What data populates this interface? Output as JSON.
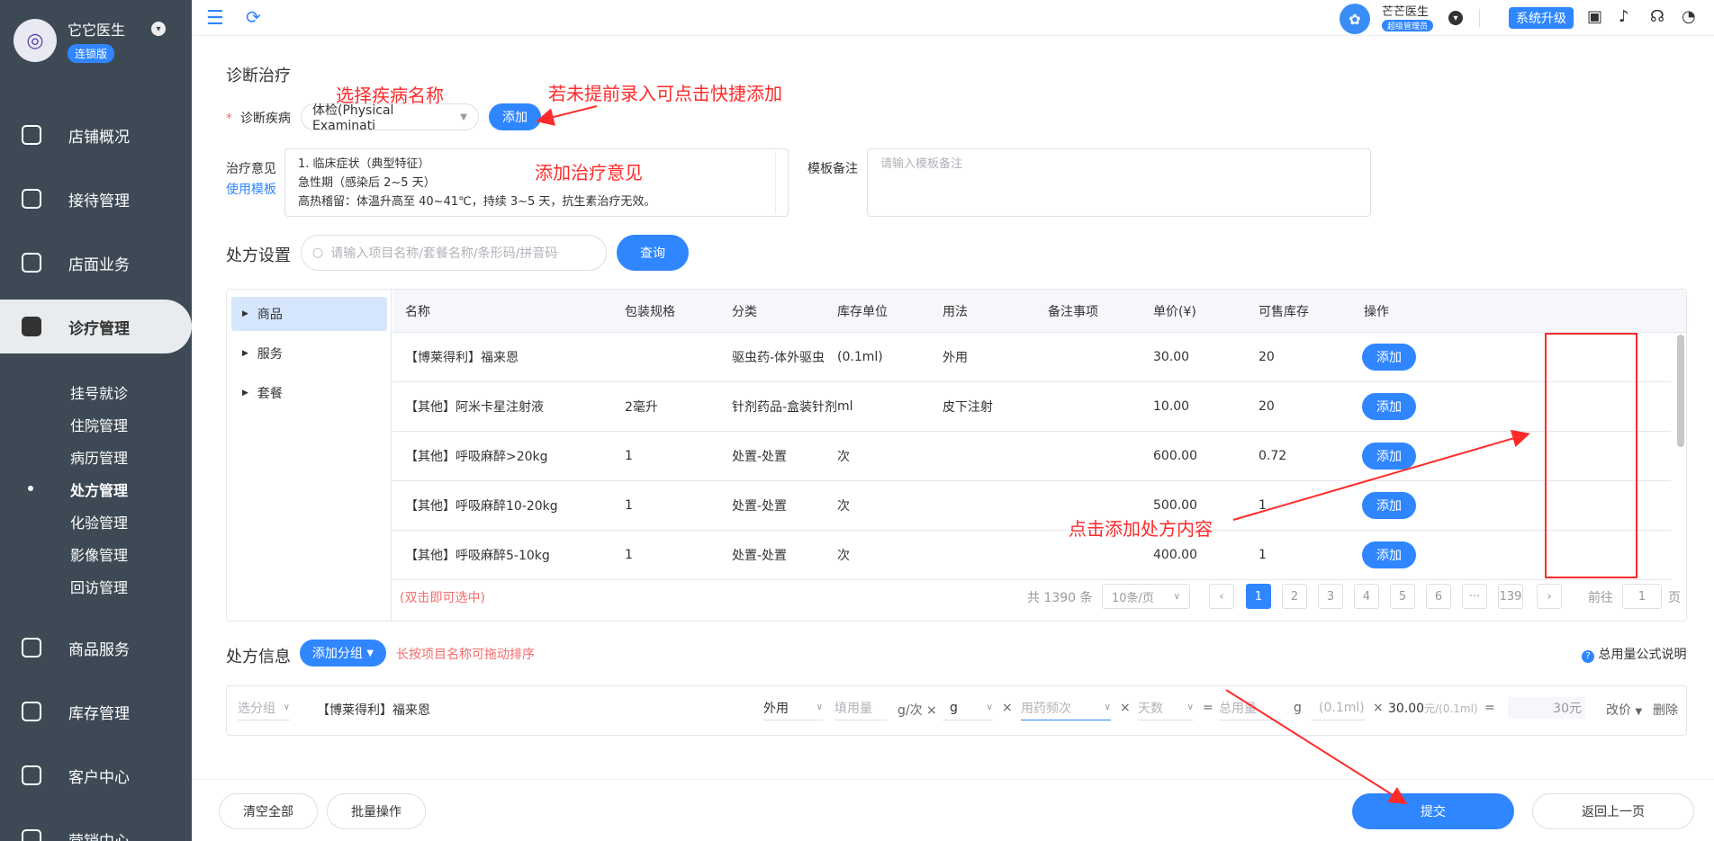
{
  "sidebar": {
    "brand_name": "它它医生",
    "brand_badge": "连锁版",
    "nav": [
      {
        "label": "店铺概况"
      },
      {
        "label": "接待管理"
      },
      {
        "label": "店面业务"
      },
      {
        "label": "诊疗管理"
      },
      {
        "label": "商品服务"
      },
      {
        "label": "库存管理"
      },
      {
        "label": "客户中心"
      },
      {
        "label": "营销中心"
      }
    ],
    "sub": [
      {
        "label": "挂号就诊"
      },
      {
        "label": "住院管理"
      },
      {
        "label": "病历管理"
      },
      {
        "label": "处方管理"
      },
      {
        "label": "化验管理"
      },
      {
        "label": "影像管理"
      },
      {
        "label": "回访管理"
      }
    ]
  },
  "topbar": {
    "user_name": "芒芒医生",
    "user_role": "超级管理员",
    "upgrade": "系统升级"
  },
  "diagnosis": {
    "title": "诊断治疗",
    "disease_label": "诊断疾病",
    "disease_value": "体检(Physical Examinati",
    "add_btn": "添加",
    "treatment_label": "治疗意见",
    "use_template": "使用模板",
    "treatment_lines": [
      "1. 临床症状（典型特征）",
      "急性期（感染后 2~5 天）",
      "高热稽留：体温升高至 40~41℃，持续 3~5 天，抗生素治疗无效。"
    ],
    "template_note_label": "模板备注",
    "template_note_placeholder": "请输入模板备注"
  },
  "annotations": {
    "select_disease": "选择疾病名称",
    "quick_add": "若未提前录入可点击快捷添加",
    "add_treatment": "添加治疗意见",
    "add_rx": "点击添加处方内容"
  },
  "rx_settings": {
    "title": "处方设置",
    "search_placeholder": "请输入项目名称/套餐名称/条形码/拼音码",
    "query_btn": "查询"
  },
  "tree": [
    "商品",
    "服务",
    "套餐"
  ],
  "table": {
    "headers": [
      "名称",
      "包装规格",
      "分类",
      "库存单位",
      "用法",
      "备注事项",
      "单价(¥)",
      "可售库存",
      "操作"
    ],
    "rows": [
      {
        "name": "【博莱得利】福来恩",
        "spec": "",
        "category": "驱虫药-体外驱虫",
        "unit": "(0.1ml)",
        "usage": "外用",
        "note": "",
        "price": "30.00",
        "stock": "20",
        "action": "添加"
      },
      {
        "name": "【其他】阿米卡星注射液",
        "spec": "2毫升",
        "category": "针剂药品-盒装针剂",
        "unit": "ml",
        "usage": "皮下注射",
        "note": "",
        "price": "10.00",
        "stock": "20",
        "action": "添加"
      },
      {
        "name": "【其他】呼吸麻醉>20kg",
        "spec": "1",
        "category": "处置-处置",
        "unit": "次",
        "usage": "",
        "note": "",
        "price": "600.00",
        "stock": "0.72",
        "action": "添加"
      },
      {
        "name": "【其他】呼吸麻醉10-20kg",
        "spec": "1",
        "category": "处置-处置",
        "unit": "次",
        "usage": "",
        "note": "",
        "price": "500.00",
        "stock": "1",
        "action": "添加"
      },
      {
        "name": "【其他】呼吸麻醉5-10kg",
        "spec": "1",
        "category": "处置-处置",
        "unit": "次",
        "usage": "",
        "note": "",
        "price": "400.00",
        "stock": "1",
        "action": "添加"
      }
    ],
    "dblclick_hint": "(双击即可选中)",
    "total": "共 1390 条",
    "page_size": "10条/页",
    "pages": [
      "1",
      "2",
      "3",
      "4",
      "5",
      "6",
      "···",
      "139"
    ],
    "goto_label": "前往",
    "goto_value": "1",
    "goto_unit": "页"
  },
  "rx_info": {
    "title": "处方信息",
    "add_group": "添加分组",
    "drag_hint": "长按项目名称可拖动排序",
    "formula_help": "总用量公式说明",
    "row": {
      "group_placeholder": "选分组",
      "name": "【博莱得利】福来恩",
      "usage": "外用",
      "dose_placeholder": "填用量",
      "dose_unit": "g/次",
      "unit_select": "g",
      "freq_placeholder": "用药频次",
      "days_placeholder": "天数",
      "total_placeholder": "总用量",
      "total_unit": "g",
      "pack_unit": "(0.1ml)",
      "unit_price": "30.00",
      "unit_price_suffix": "元/(0.1ml)",
      "amount": "30元",
      "reprice": "改价",
      "delete": "删除"
    }
  },
  "footer": {
    "clear_all": "清空全部",
    "batch_op": "批量操作",
    "submit": "提交",
    "back": "返回上一页"
  },
  "colors": {
    "primary": "#2f86ff",
    "sidebar": "#3d4a55",
    "annotation": "#ff2a2a"
  }
}
